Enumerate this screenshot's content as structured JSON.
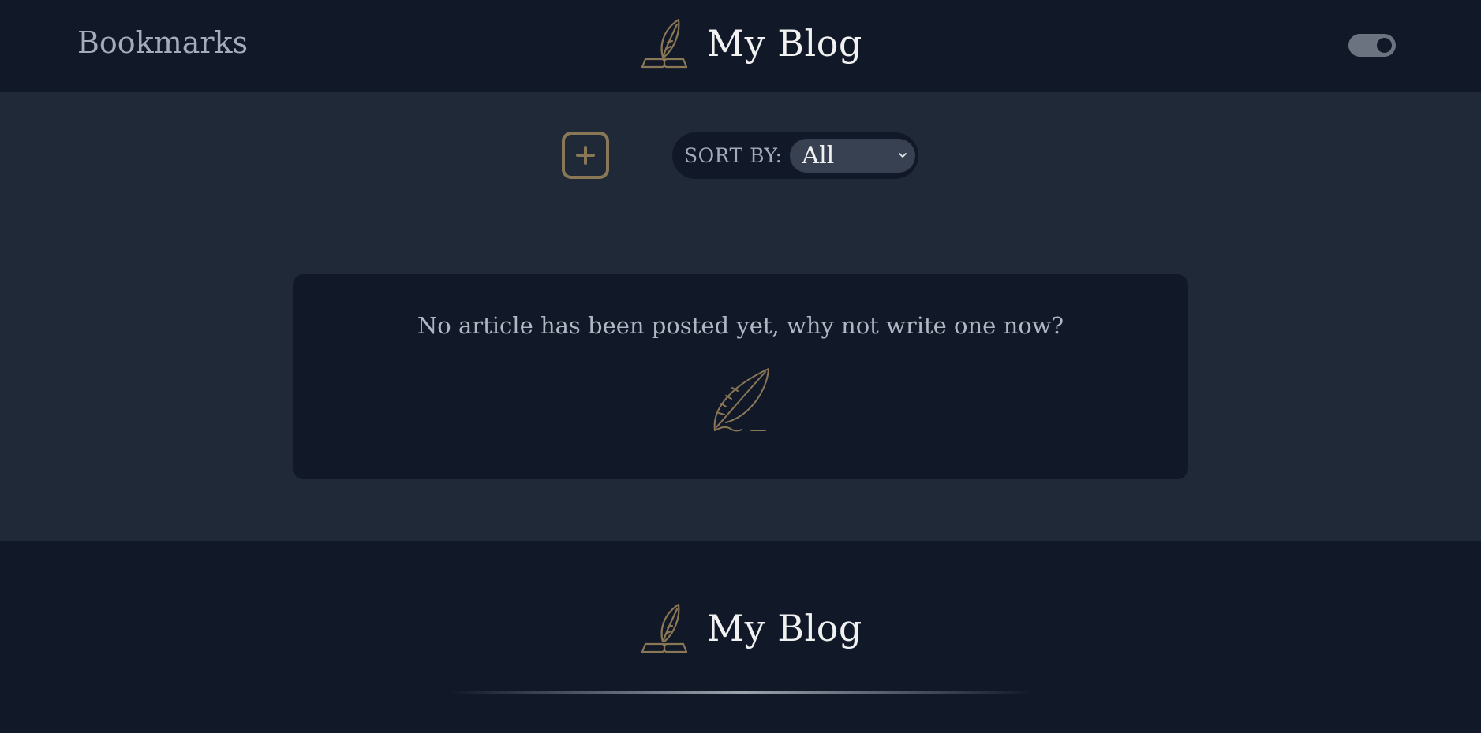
{
  "header": {
    "bookmarks_label": "Bookmarks",
    "brand_title": "My Blog",
    "brand_icon": "book-quill-icon",
    "theme_toggle_state": "on"
  },
  "toolbar": {
    "add_icon": "plus-square-icon",
    "sort_label": "SORT BY:",
    "sort_selected": "All"
  },
  "content": {
    "empty_message": "No article has been posted yet, why not write one now?",
    "empty_icon": "quill-icon"
  },
  "footer": {
    "brand_title": "My Blog",
    "brand_icon": "book-quill-icon"
  },
  "colors": {
    "header_bg": "#111827",
    "main_bg": "#1f2937",
    "accent": "#8a7756",
    "text_muted": "#a3acbb",
    "text_light": "#f1f1f1"
  }
}
